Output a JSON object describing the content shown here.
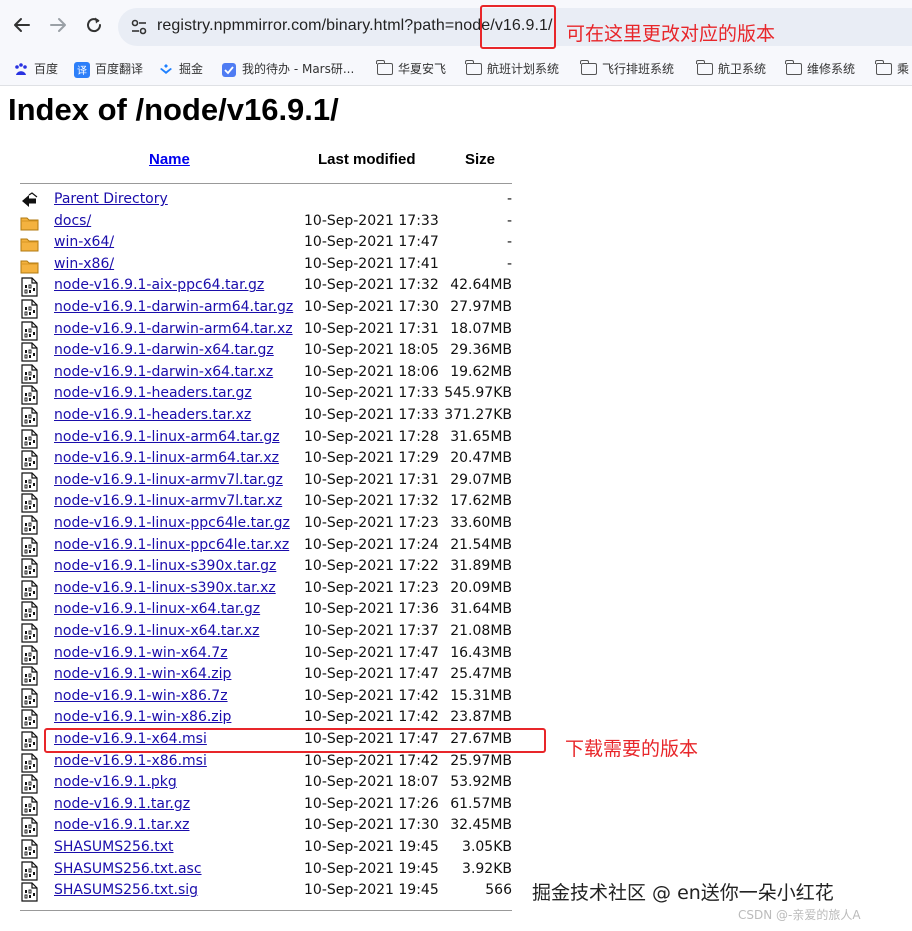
{
  "browser": {
    "url": "registry.npmmirror.com/binary.html?path=node/v16.9.1/",
    "back_icon": "arrow-left-icon",
    "forward_icon": "arrow-right-icon",
    "reload_icon": "reload-icon"
  },
  "annotations": {
    "url_note": "可在这里更改对应的版本",
    "row_note": "下载需要的版本",
    "color": "#e8262a"
  },
  "bookmarks": [
    {
      "label": "百度",
      "icon": "baidu-paw-icon"
    },
    {
      "label": "百度翻译",
      "icon": "baidu-translate-icon"
    },
    {
      "label": "掘金",
      "icon": "juejin-icon"
    },
    {
      "label": "我的待办 - Mars研...",
      "icon": "todo-icon"
    },
    {
      "label": "华夏安飞",
      "icon": "folder-icon"
    },
    {
      "label": "航班计划系统",
      "icon": "folder-icon"
    },
    {
      "label": "飞行排班系统",
      "icon": "folder-icon"
    },
    {
      "label": "航卫系统",
      "icon": "folder-icon"
    },
    {
      "label": "维修系统",
      "icon": "folder-icon"
    },
    {
      "label": "乘",
      "icon": "folder-icon"
    }
  ],
  "page": {
    "title": "Index of /node/v16.9.1/",
    "columns": {
      "name": "Name",
      "modified": "Last modified",
      "size": "Size"
    }
  },
  "files": [
    {
      "name": "Parent Directory",
      "modified": "",
      "size": "-",
      "icon": "back-arrow-icon"
    },
    {
      "name": "docs/",
      "modified": "10-Sep-2021 17:33",
      "size": "-",
      "icon": "folder-icon"
    },
    {
      "name": "win-x64/",
      "modified": "10-Sep-2021 17:47",
      "size": "-",
      "icon": "folder-icon"
    },
    {
      "name": "win-x86/",
      "modified": "10-Sep-2021 17:41",
      "size": "-",
      "icon": "folder-icon"
    },
    {
      "name": "node-v16.9.1-aix-ppc64.tar.gz",
      "modified": "10-Sep-2021 17:32",
      "size": "42.64MB",
      "icon": "binary-file-icon"
    },
    {
      "name": "node-v16.9.1-darwin-arm64.tar.gz",
      "modified": "10-Sep-2021 17:30",
      "size": "27.97MB",
      "icon": "binary-file-icon"
    },
    {
      "name": "node-v16.9.1-darwin-arm64.tar.xz",
      "modified": "10-Sep-2021 17:31",
      "size": "18.07MB",
      "icon": "binary-file-icon"
    },
    {
      "name": "node-v16.9.1-darwin-x64.tar.gz",
      "modified": "10-Sep-2021 18:05",
      "size": "29.36MB",
      "icon": "binary-file-icon"
    },
    {
      "name": "node-v16.9.1-darwin-x64.tar.xz",
      "modified": "10-Sep-2021 18:06",
      "size": "19.62MB",
      "icon": "binary-file-icon"
    },
    {
      "name": "node-v16.9.1-headers.tar.gz",
      "modified": "10-Sep-2021 17:33",
      "size": "545.97KB",
      "icon": "binary-file-icon"
    },
    {
      "name": "node-v16.9.1-headers.tar.xz",
      "modified": "10-Sep-2021 17:33",
      "size": "371.27KB",
      "icon": "binary-file-icon"
    },
    {
      "name": "node-v16.9.1-linux-arm64.tar.gz",
      "modified": "10-Sep-2021 17:28",
      "size": "31.65MB",
      "icon": "binary-file-icon"
    },
    {
      "name": "node-v16.9.1-linux-arm64.tar.xz",
      "modified": "10-Sep-2021 17:29",
      "size": "20.47MB",
      "icon": "binary-file-icon"
    },
    {
      "name": "node-v16.9.1-linux-armv7l.tar.gz",
      "modified": "10-Sep-2021 17:31",
      "size": "29.07MB",
      "icon": "binary-file-icon"
    },
    {
      "name": "node-v16.9.1-linux-armv7l.tar.xz",
      "modified": "10-Sep-2021 17:32",
      "size": "17.62MB",
      "icon": "binary-file-icon"
    },
    {
      "name": "node-v16.9.1-linux-ppc64le.tar.gz",
      "modified": "10-Sep-2021 17:23",
      "size": "33.60MB",
      "icon": "binary-file-icon"
    },
    {
      "name": "node-v16.9.1-linux-ppc64le.tar.xz",
      "modified": "10-Sep-2021 17:24",
      "size": "21.54MB",
      "icon": "binary-file-icon"
    },
    {
      "name": "node-v16.9.1-linux-s390x.tar.gz",
      "modified": "10-Sep-2021 17:22",
      "size": "31.89MB",
      "icon": "binary-file-icon"
    },
    {
      "name": "node-v16.9.1-linux-s390x.tar.xz",
      "modified": "10-Sep-2021 17:23",
      "size": "20.09MB",
      "icon": "binary-file-icon"
    },
    {
      "name": "node-v16.9.1-linux-x64.tar.gz",
      "modified": "10-Sep-2021 17:36",
      "size": "31.64MB",
      "icon": "binary-file-icon"
    },
    {
      "name": "node-v16.9.1-linux-x64.tar.xz",
      "modified": "10-Sep-2021 17:37",
      "size": "21.08MB",
      "icon": "binary-file-icon"
    },
    {
      "name": "node-v16.9.1-win-x64.7z",
      "modified": "10-Sep-2021 17:47",
      "size": "16.43MB",
      "icon": "binary-file-icon"
    },
    {
      "name": "node-v16.9.1-win-x64.zip",
      "modified": "10-Sep-2021 17:47",
      "size": "25.47MB",
      "icon": "binary-file-icon"
    },
    {
      "name": "node-v16.9.1-win-x86.7z",
      "modified": "10-Sep-2021 17:42",
      "size": "15.31MB",
      "icon": "binary-file-icon"
    },
    {
      "name": "node-v16.9.1-win-x86.zip",
      "modified": "10-Sep-2021 17:42",
      "size": "23.87MB",
      "icon": "binary-file-icon"
    },
    {
      "name": "node-v16.9.1-x64.msi",
      "modified": "10-Sep-2021 17:47",
      "size": "27.67MB",
      "icon": "binary-file-icon"
    },
    {
      "name": "node-v16.9.1-x86.msi",
      "modified": "10-Sep-2021 17:42",
      "size": "25.97MB",
      "icon": "binary-file-icon"
    },
    {
      "name": "node-v16.9.1.pkg",
      "modified": "10-Sep-2021 18:07",
      "size": "53.92MB",
      "icon": "binary-file-icon"
    },
    {
      "name": "node-v16.9.1.tar.gz",
      "modified": "10-Sep-2021 17:26",
      "size": "61.57MB",
      "icon": "binary-file-icon"
    },
    {
      "name": "node-v16.9.1.tar.xz",
      "modified": "10-Sep-2021 17:30",
      "size": "32.45MB",
      "icon": "binary-file-icon"
    },
    {
      "name": "SHASUMS256.txt",
      "modified": "10-Sep-2021 19:45",
      "size": "3.05KB",
      "icon": "binary-file-icon"
    },
    {
      "name": "SHASUMS256.txt.asc",
      "modified": "10-Sep-2021 19:45",
      "size": "3.92KB",
      "icon": "binary-file-icon"
    },
    {
      "name": "SHASUMS256.txt.sig",
      "modified": "10-Sep-2021 19:45",
      "size": "566",
      "icon": "binary-file-icon"
    }
  ],
  "watermarks": {
    "juejin": "掘金技术社区 @ en送你一朵小红花",
    "csdn": "CSDN @-亲爱的旅人A"
  }
}
